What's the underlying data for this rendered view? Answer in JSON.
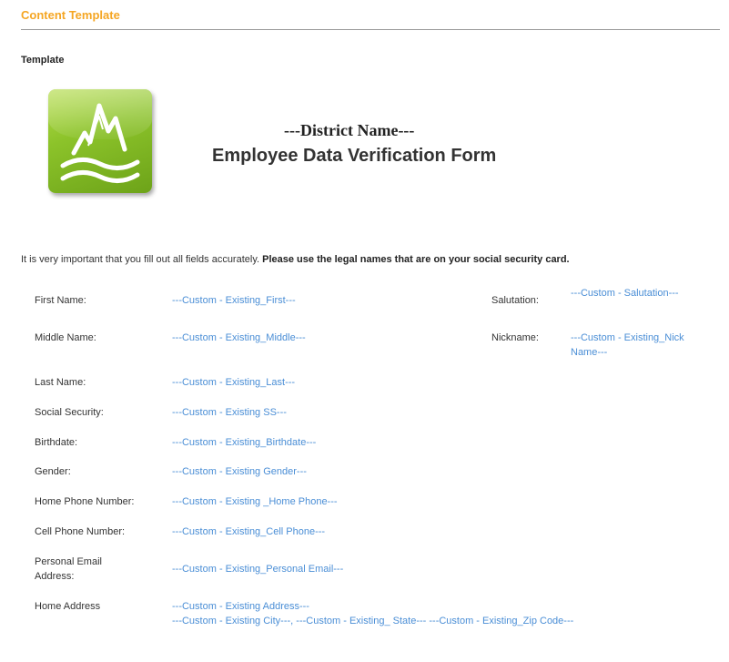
{
  "section": {
    "title": "Content Template"
  },
  "template_label": "Template",
  "logo": {
    "icon": "mountain-logo-icon",
    "colors": {
      "light": "#b4dc4a",
      "dark": "#6da319"
    }
  },
  "form": {
    "district": "---District Name---",
    "title": "Employee Data Verification Form",
    "intro_text": "It is very important that you fill out all fields accurately.",
    "intro_bold": "Please use the legal names that are on your social security card."
  },
  "fields": {
    "first_name": {
      "label": "First Name:",
      "value": "---Custom - Existing_First---"
    },
    "salutation": {
      "label": "Salutation:",
      "value": "---Custom - Salutation---"
    },
    "middle_name": {
      "label": "Middle Name:",
      "value": "---Custom - Existing_Middle---"
    },
    "nickname": {
      "label": "Nickname:",
      "value": "---Custom - Existing_Nick Name---"
    },
    "last_name": {
      "label": "Last Name:",
      "value": "---Custom - Existing_Last---"
    },
    "social_security": {
      "label": "Social Security:",
      "value": "---Custom - Existing SS---"
    },
    "birthdate": {
      "label": "Birthdate:",
      "value": "---Custom - Existing_Birthdate---"
    },
    "gender": {
      "label": "Gender:",
      "value": "---Custom - Existing Gender---"
    },
    "home_phone": {
      "label": "Home Phone Number:",
      "value": "---Custom - Existing _Home Phone---"
    },
    "cell_phone": {
      "label": "Cell Phone Number:",
      "value": "---Custom - Existing_Cell Phone---"
    },
    "personal_email": {
      "label": "Personal Email Address:",
      "value": "---Custom - Existing_Personal Email---"
    },
    "home_address": {
      "label": "Home Address",
      "line1": "---Custom - Existing Address---",
      "line2": "---Custom - Existing City---, ---Custom - Existing_ State--- ---Custom - Existing_Zip Code---"
    }
  },
  "colors": {
    "accent": "#f5a623",
    "link": "#4a8ed6"
  }
}
